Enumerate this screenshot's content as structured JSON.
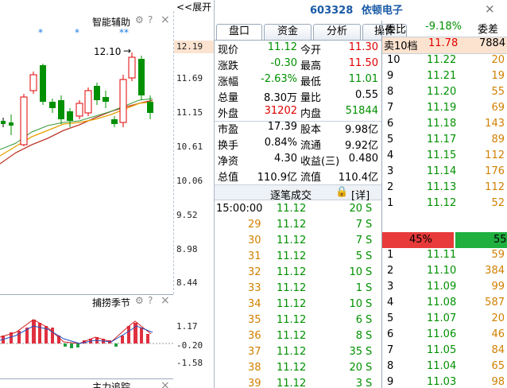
{
  "header": {
    "expand_label": "<<展开",
    "stock_code": "603328",
    "stock_name": "依顿电子",
    "close_symbol": "×"
  },
  "indicator_panel": {
    "title": "智能辅助",
    "stars": [
      "*",
      "*",
      "**"
    ],
    "price_marker": "12.10",
    "price_levels": [
      "12.19",
      "11.69",
      "11.15",
      "10.61",
      "10.06",
      "9.52",
      "8.98",
      "8.44"
    ]
  },
  "season_panel": {
    "title": "捕捞季节",
    "levels": [
      "1.17",
      "-0.20",
      "-1.58"
    ]
  },
  "bottom_panel_title": "主力追踪",
  "tabs": [
    "盘口",
    "资金",
    "分析",
    "操作"
  ],
  "quote": {
    "rows": [
      {
        "l1": "现价",
        "v1": "11.12",
        "l2": "今开",
        "v2": "11.30"
      },
      {
        "l1": "涨跌",
        "v1": "-0.30",
        "l2": "最高",
        "v2": "11.50"
      },
      {
        "l1": "涨幅",
        "v1": "-2.63%",
        "l2": "最低",
        "v2": "11.01"
      },
      {
        "l1": "总量",
        "v1": "8.30万",
        "l2": "量比",
        "v2": "0.55"
      },
      {
        "l1": "外盘",
        "v1": "31202",
        "l2": "内盘",
        "v2": "51844"
      },
      {
        "l1": "市盈",
        "v1": "17.39",
        "l2": "股本",
        "v2": "9.98亿"
      },
      {
        "l1": "换手",
        "v1": "0.84%",
        "l2": "流通",
        "v2": "9.92亿"
      },
      {
        "l1": "净资",
        "v1": "4.30",
        "l2": "收益(三)",
        "v2": "0.480"
      },
      {
        "l1": "总值",
        "v1": "110.9亿",
        "l2": "流值",
        "v2": "110.4亿"
      }
    ]
  },
  "trades": {
    "title": "逐笔成交",
    "detail": "[详]",
    "rows": [
      {
        "time": "15:00:00",
        "price": "11.12",
        "vol": "20",
        "side": "S"
      },
      {
        "time": "29",
        "price": "11.12",
        "vol": "7",
        "side": "S"
      },
      {
        "time": "30",
        "price": "11.12",
        "vol": "7",
        "side": "S"
      },
      {
        "time": "31",
        "price": "11.12",
        "vol": "5",
        "side": "S"
      },
      {
        "time": "32",
        "price": "11.12",
        "vol": "10",
        "side": "S"
      },
      {
        "time": "33",
        "price": "11.12",
        "vol": "1",
        "side": "S"
      },
      {
        "time": "34",
        "price": "11.12",
        "vol": "10",
        "side": "S"
      },
      {
        "time": "35",
        "price": "11.12",
        "vol": "6",
        "side": "S"
      },
      {
        "time": "36",
        "price": "11.12",
        "vol": "8",
        "side": "S"
      },
      {
        "time": "37",
        "price": "11.12",
        "vol": "35",
        "side": "S"
      },
      {
        "time": "38",
        "price": "11.12",
        "vol": "20",
        "side": "S"
      },
      {
        "time": "39",
        "price": "11.12",
        "vol": "3",
        "side": "S"
      }
    ]
  },
  "orderbook": {
    "weibi_label": "委比",
    "weibi_value": "-9.18%",
    "weicha_label": "委差",
    "sell10_label": "卖10档",
    "sell10_price": "11.78",
    "sell10_vol": "7884",
    "asks": [
      {
        "lvl": "10",
        "price": "11.22",
        "vol": "20"
      },
      {
        "lvl": "9",
        "price": "11.21",
        "vol": "19"
      },
      {
        "lvl": "8",
        "price": "11.20",
        "vol": "55"
      },
      {
        "lvl": "7",
        "price": "11.19",
        "vol": "69"
      },
      {
        "lvl": "6",
        "price": "11.18",
        "vol": "143"
      },
      {
        "lvl": "5",
        "price": "11.17",
        "vol": "89"
      },
      {
        "lvl": "4",
        "price": "11.15",
        "vol": "112"
      },
      {
        "lvl": "3",
        "price": "11.14",
        "vol": "176"
      },
      {
        "lvl": "2",
        "price": "11.13",
        "vol": "112"
      },
      {
        "lvl": "1",
        "price": "11.12",
        "vol": "52"
      }
    ],
    "bar_left": "45%",
    "bar_right": "55",
    "bar_left_fraction": 0.45,
    "bids": [
      {
        "lvl": "1",
        "price": "11.11",
        "vol": "59"
      },
      {
        "lvl": "2",
        "price": "11.10",
        "vol": "384"
      },
      {
        "lvl": "3",
        "price": "11.09",
        "vol": "99"
      },
      {
        "lvl": "4",
        "price": "11.08",
        "vol": "587"
      },
      {
        "lvl": "5",
        "price": "11.07",
        "vol": "20"
      },
      {
        "lvl": "6",
        "price": "11.06",
        "vol": "46"
      },
      {
        "lvl": "7",
        "price": "11.05",
        "vol": "84"
      },
      {
        "lvl": "8",
        "price": "11.04",
        "vol": "65"
      },
      {
        "lvl": "9",
        "price": "11.03",
        "vol": "98"
      }
    ]
  },
  "colors": {
    "up": "#e00000",
    "down": "#009000",
    "code": "#1a5aa6",
    "ma_red": "#c0392b",
    "ma_orange": "#e6a000"
  }
}
